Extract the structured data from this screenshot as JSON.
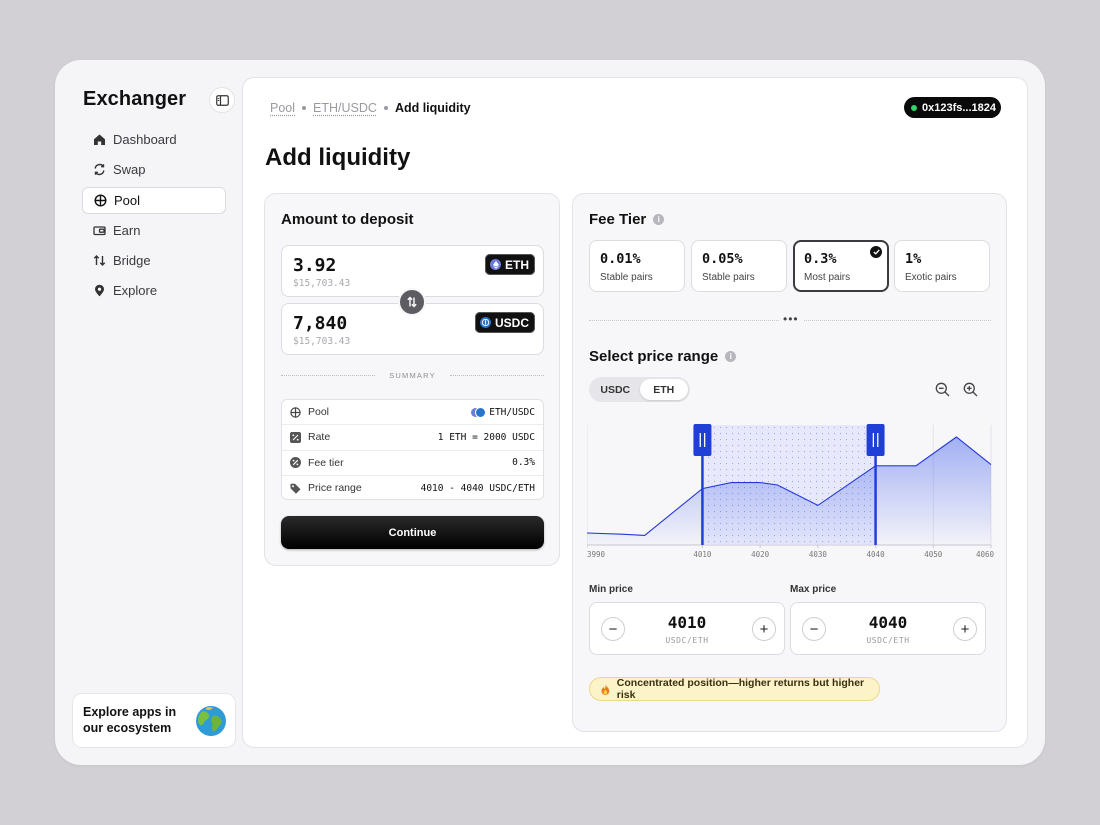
{
  "app": {
    "name": "Exchanger"
  },
  "sidebar": {
    "items": [
      {
        "label": "Dashboard",
        "icon": "home-icon",
        "active": false
      },
      {
        "label": "Swap",
        "icon": "swap-icon",
        "active": false
      },
      {
        "label": "Pool",
        "icon": "pool-icon",
        "active": true
      },
      {
        "label": "Earn",
        "icon": "earn-icon",
        "active": false
      },
      {
        "label": "Bridge",
        "icon": "bridge-icon",
        "active": false
      },
      {
        "label": "Explore",
        "icon": "location-pin-icon",
        "active": false
      }
    ],
    "explore_card": {
      "text": "Explore apps in our ecosystem",
      "icon": "globe-icon"
    }
  },
  "breadcrumb": {
    "items": [
      "Pool",
      "ETH/USDC"
    ],
    "current": "Add liquidity"
  },
  "wallet": {
    "address": "0x123fs...1824",
    "status_color": "#2fd46b"
  },
  "page": {
    "title": "Add liquidity"
  },
  "deposit": {
    "title": "Amount to deposit",
    "token_a": {
      "amount": "3.92",
      "usd": "$15,703.43",
      "symbol": "ETH",
      "icon_color": "#6c7bd9"
    },
    "token_b": {
      "amount": "7,840",
      "usd": "$15,703.43",
      "symbol": "USDC",
      "icon_color": "#2775ca"
    },
    "summary_label": "SUMMARY",
    "summary": [
      {
        "label": "Pool",
        "value": "ETH/USDC",
        "icon": "pool-icon"
      },
      {
        "label": "Rate",
        "value": "1 ETH = 2000 USDC",
        "icon": "rate-icon"
      },
      {
        "label": "Fee tier",
        "value": "0.3%",
        "icon": "percent-icon"
      },
      {
        "label": "Price range",
        "value": "4010 - 4040 USDC/ETH",
        "icon": "tag-icon"
      }
    ],
    "continue_label": "Continue"
  },
  "fee_tier": {
    "title": "Fee Tier",
    "tiers": [
      {
        "pct": "0.01%",
        "desc": "Stable pairs",
        "selected": false
      },
      {
        "pct": "0.05%",
        "desc": "Stable pairs",
        "selected": false
      },
      {
        "pct": "0.3%",
        "desc": "Most pairs",
        "selected": true
      },
      {
        "pct": "1%",
        "desc": "Exotic pairs",
        "selected": false
      }
    ],
    "divider": "•••"
  },
  "price_range": {
    "title": "Select price range",
    "toggle": [
      "USDC",
      "ETH"
    ],
    "toggle_selected": "ETH",
    "min_label": "Min price",
    "max_label": "Max price",
    "min_value": "4010",
    "max_value": "4040",
    "unit": "USDC/ETH",
    "warning": "Concentrated position—higher returns but higher risk",
    "accent_color": "#1f3fd6"
  },
  "chart_data": {
    "type": "area",
    "x_ticks": [
      3990,
      4010,
      4020,
      4030,
      4040,
      4050,
      4060
    ],
    "x": [
      3990,
      3996,
      4000,
      4010,
      4015,
      4020,
      4023,
      4030,
      4040,
      4047,
      4054,
      4060
    ],
    "y": [
      10,
      9,
      8,
      47,
      52,
      52,
      50,
      33,
      66,
      66,
      90,
      67
    ],
    "xlim": [
      3990,
      4060
    ],
    "ylim": [
      0,
      100
    ],
    "selected_range": [
      4010,
      4040
    ],
    "grid": true
  }
}
